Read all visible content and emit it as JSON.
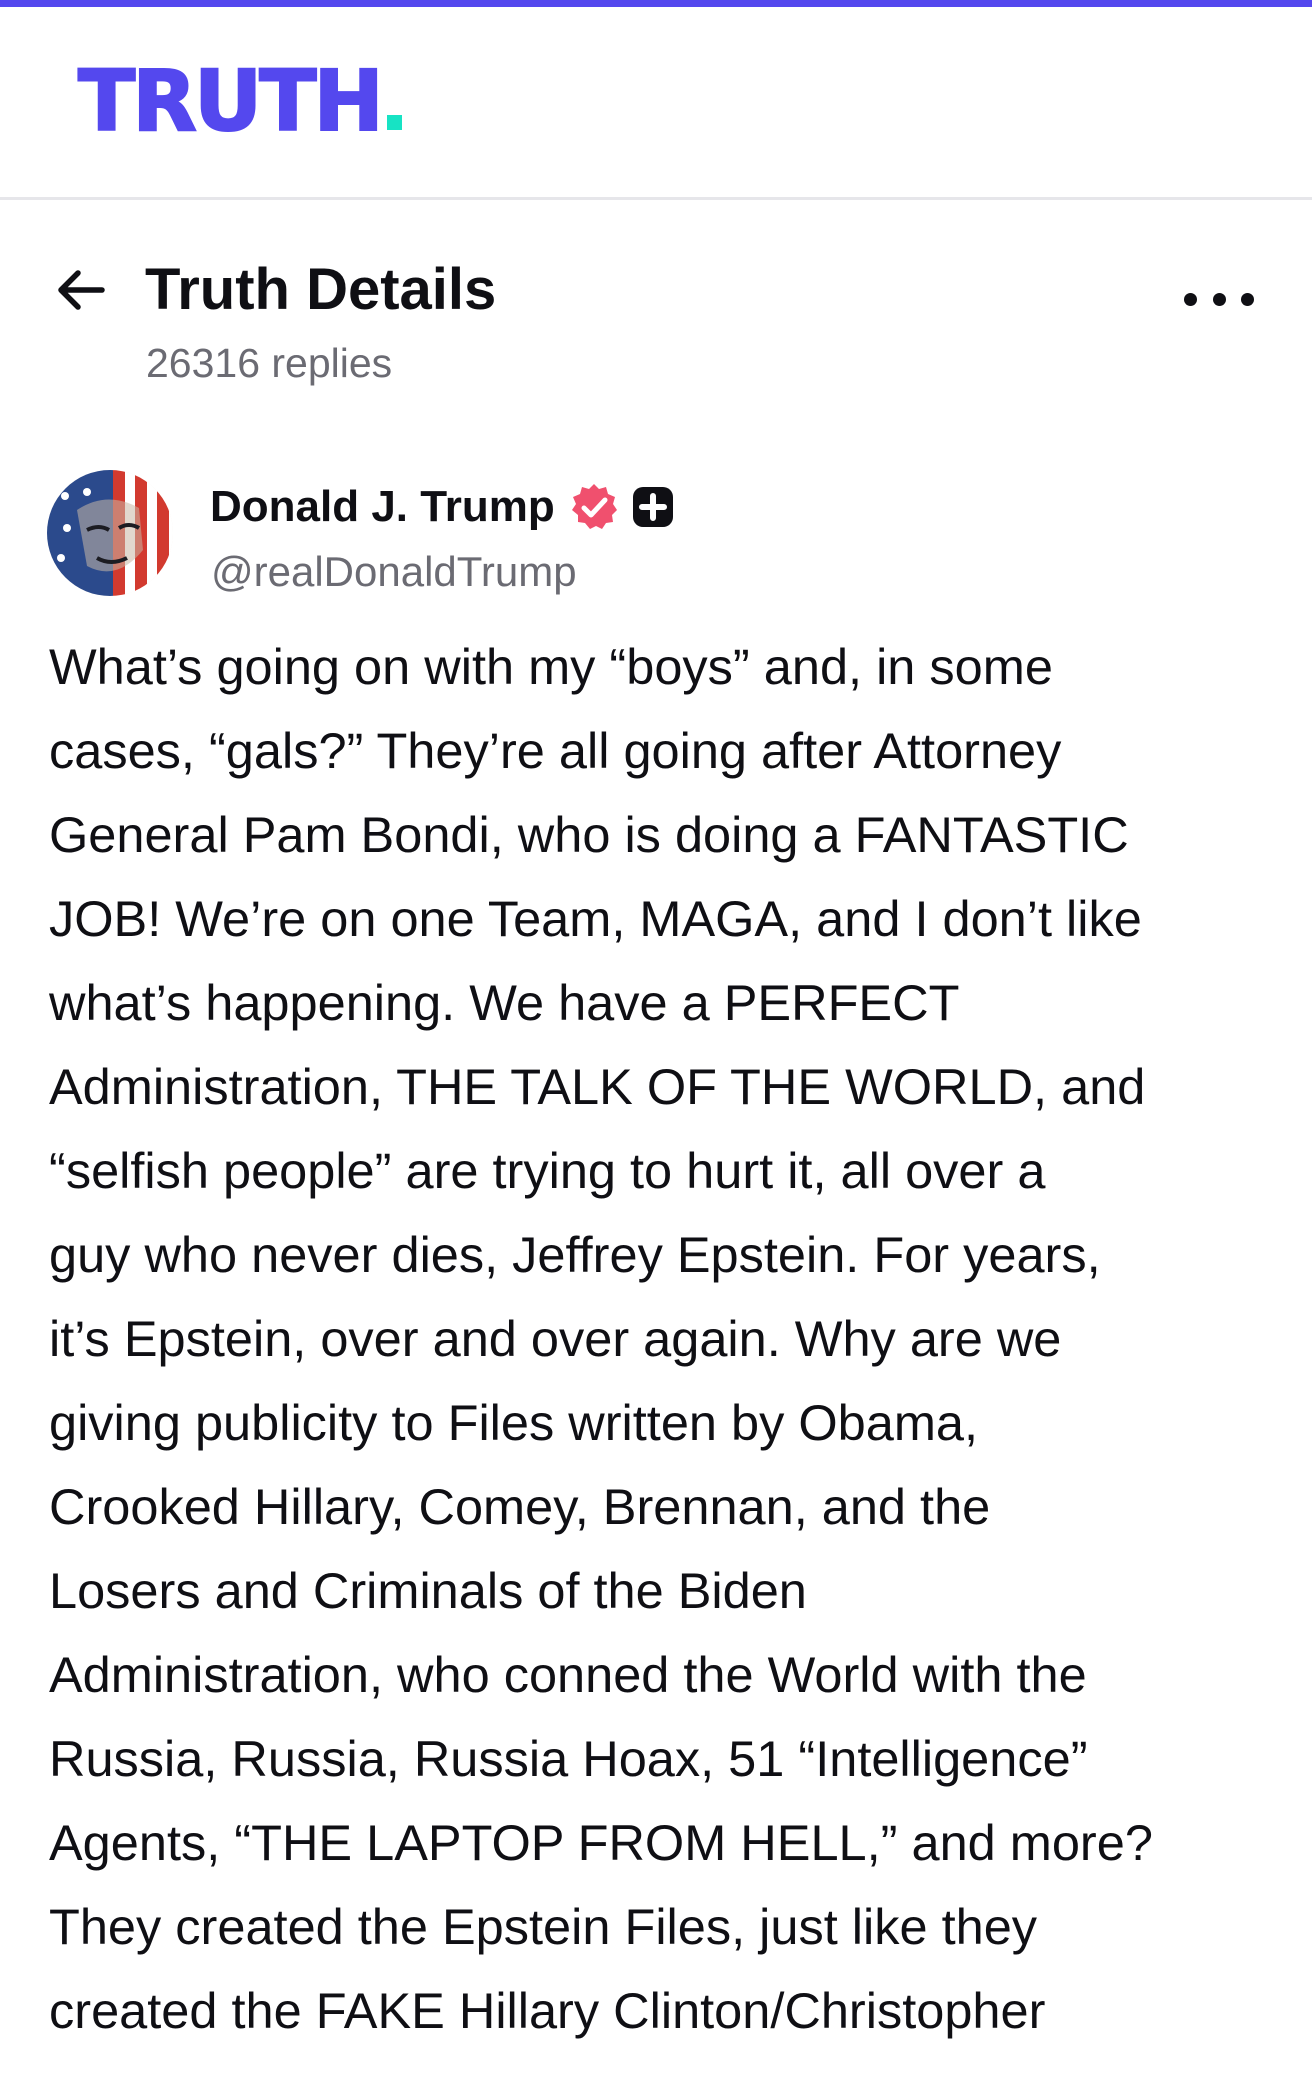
{
  "app": {
    "logo_text": "TRUTH",
    "brand_color": "#5448ee",
    "accent_color": "#17e3c4"
  },
  "header": {
    "back_icon": "arrow-left-icon",
    "title": "Truth Details",
    "replies": "26316 replies",
    "more_icon": "more-horizontal-icon"
  },
  "post": {
    "author_name": "Donald J. Trump",
    "verified_icon": "verified-badge-icon",
    "plus_icon": "plus-badge-icon",
    "handle": "@realDonaldTrump",
    "lines": [
      "What’s going on with my “boys” and, in some",
      "cases, “gals?” They’re all going after Attorney",
      "General Pam Bondi, who is doing a FANTASTIC",
      "JOB! We’re on one Team, MAGA, and I don’t like",
      "what’s happening. We have a PERFECT",
      "Administration, THE TALK OF THE WORLD, and",
      "“selfish people” are trying to hurt it, all over a",
      "guy who never dies, Jeffrey Epstein. For years,",
      "it’s Epstein, over and over again. Why are we",
      "giving publicity to Files written by Obama,",
      "Crooked Hillary, Comey, Brennan, and the",
      "Losers and Criminals of the Biden",
      "Administration, who conned the World with the",
      "Russia, Russia, Russia Hoax, 51 “Intelligence”",
      "Agents, “THE LAPTOP FROM HELL,” and more?",
      "They created the Epstein Files, just like they",
      "created the FAKE Hillary Clinton/Christopher"
    ]
  }
}
